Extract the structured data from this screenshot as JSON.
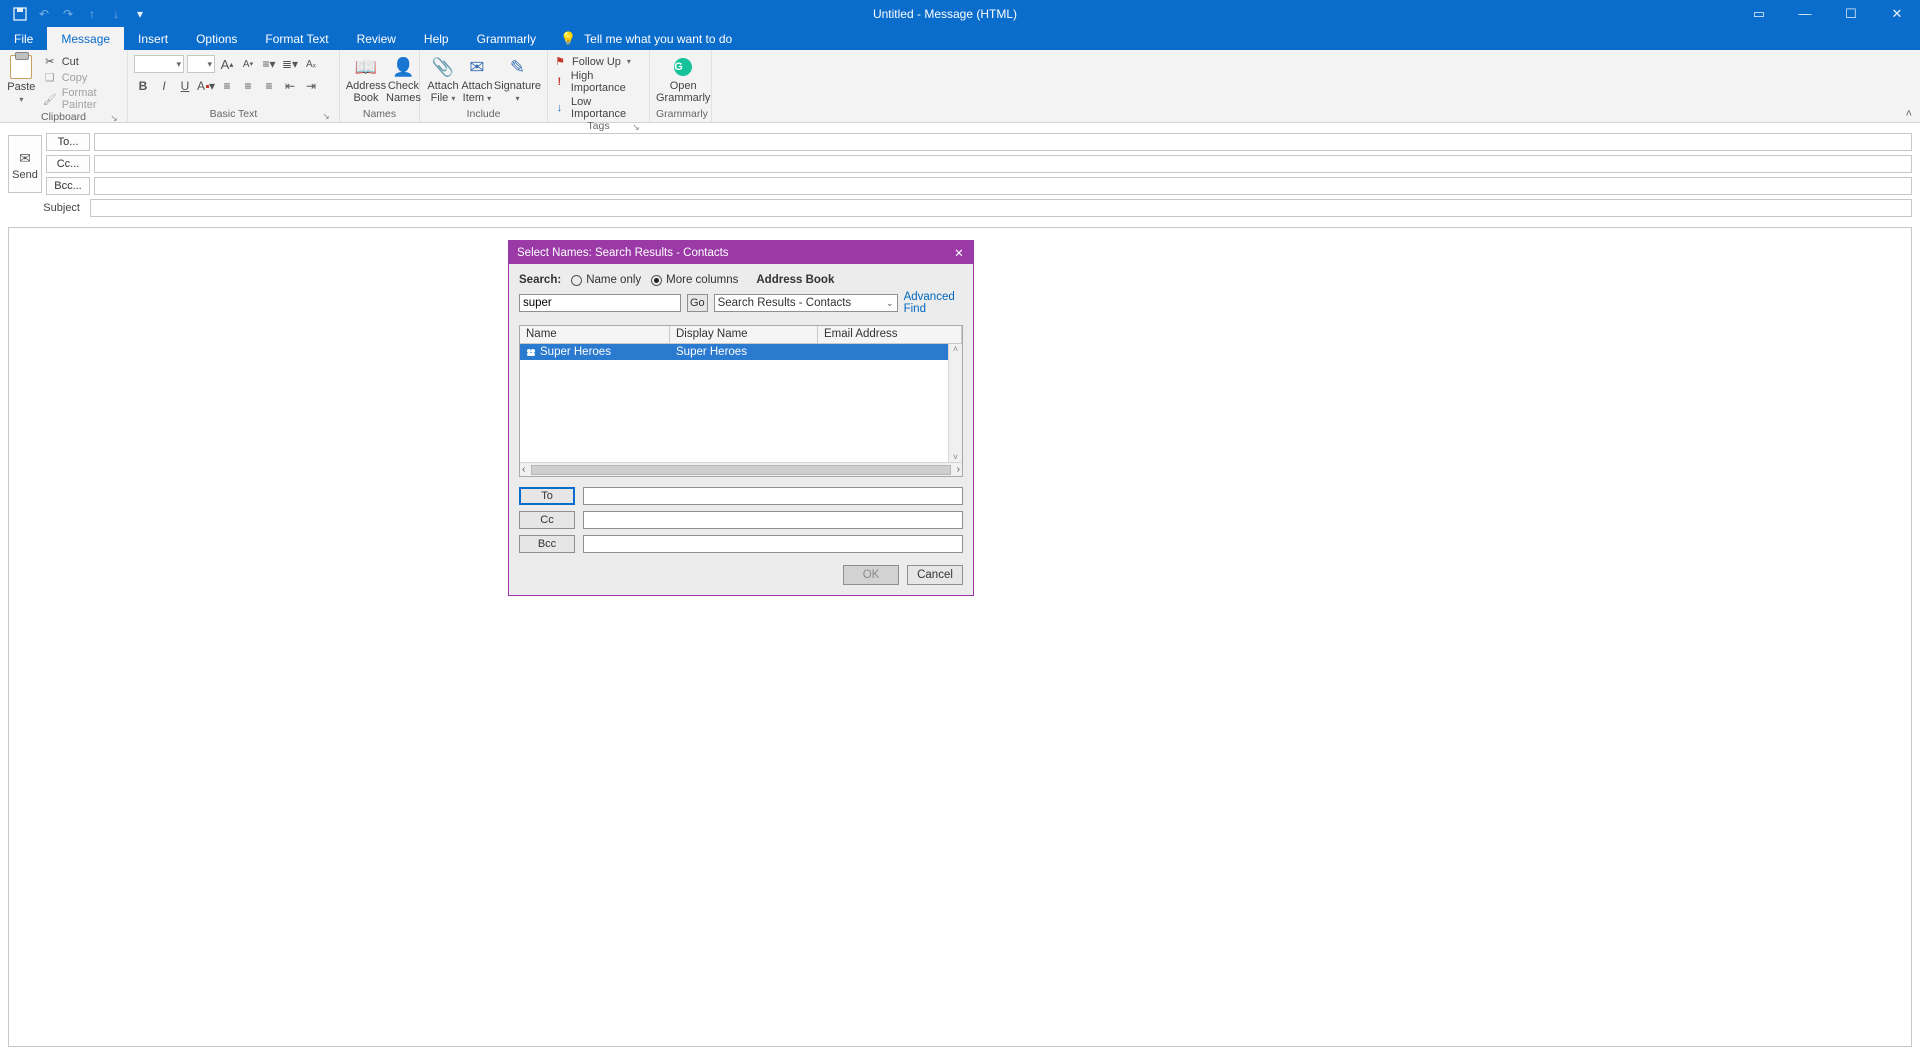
{
  "window": {
    "title": "Untitled  -  Message (HTML)"
  },
  "tabs": {
    "file": "File",
    "message": "Message",
    "insert": "Insert",
    "options": "Options",
    "format_text": "Format Text",
    "review": "Review",
    "help": "Help",
    "grammarly": "Grammarly",
    "tell_me": "Tell me what you want to do"
  },
  "ribbon": {
    "clipboard": {
      "label": "Clipboard",
      "paste": "Paste",
      "cut": "Cut",
      "copy": "Copy",
      "format_painter": "Format Painter"
    },
    "basic_text": {
      "label": "Basic Text",
      "bold": "B",
      "italic": "I",
      "underline": "U",
      "font_color": "A",
      "grow": "A",
      "shrink": "A"
    },
    "names": {
      "label": "Names",
      "address_book": "Address\nBook",
      "check_names": "Check\nNames"
    },
    "include": {
      "label": "Include",
      "attach_file": "Attach\nFile",
      "attach_item": "Attach\nItem",
      "signature": "Signature"
    },
    "tags": {
      "label": "Tags",
      "follow_up": "Follow Up",
      "high": "High Importance",
      "low": "Low Importance"
    },
    "grammarly_grp": {
      "label": "Grammarly",
      "open": "Open\nGrammarly"
    }
  },
  "compose": {
    "send": "Send",
    "to": "To...",
    "cc": "Cc...",
    "bcc": "Bcc...",
    "subject": "Subject"
  },
  "dialog": {
    "title": "Select Names: Search Results - Contacts",
    "search_label": "Search:",
    "name_only": "Name only",
    "more_columns": "More columns",
    "address_book": "Address Book",
    "search_value": "super",
    "go": "Go",
    "combo_value": "Search Results - Contacts",
    "advanced_find": "Advanced Find",
    "cols": {
      "name": "Name",
      "display": "Display Name",
      "email": "Email Address"
    },
    "rows": [
      {
        "name": "Super Heroes",
        "display": "Super Heroes"
      }
    ],
    "to": "To",
    "cc": "Cc",
    "bcc": "Bcc",
    "ok": "OK",
    "cancel": "Cancel"
  }
}
